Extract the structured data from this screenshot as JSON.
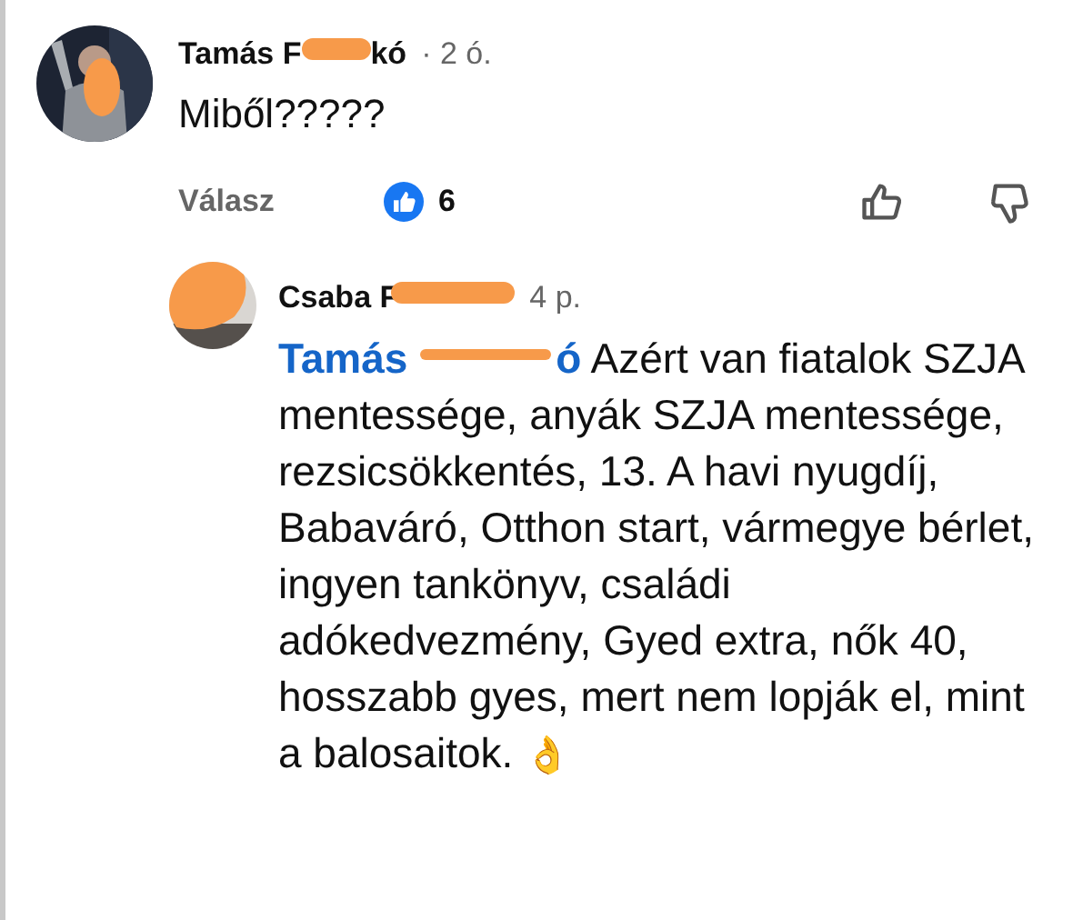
{
  "comment": {
    "author_parts": [
      "Tamás F",
      "kó"
    ],
    "time": "· 2 ó.",
    "text": "Miből?????",
    "reply_label": "Válasz",
    "reaction_count": "6"
  },
  "reply": {
    "author_parts": [
      "Csaba F"
    ],
    "time": "4 p.",
    "mention_parts": [
      "Tamás",
      "ó"
    ],
    "text": "Azért van fiatalok SZJA mentessége, anyák SZJA mentessége, rezsicsökkentés, 13. A havi nyugdíj, Babaváró, Otthon start, vármegye bérlet, ingyen tankönyv, családi adókedvezmény, Gyed extra, nők 40, hosszabb gyes, mert nem lopják el, mint a balosaitok.",
    "emoji": "👌"
  }
}
